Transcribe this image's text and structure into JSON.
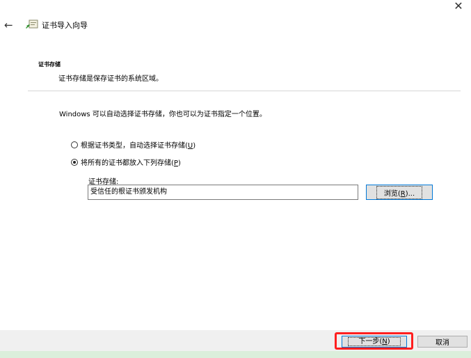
{
  "window": {
    "close_icon": "close-icon",
    "back_icon": "back-arrow-icon"
  },
  "header": {
    "title": "证书导入向导",
    "icon": "certificate-wizard-icon"
  },
  "section": {
    "title": "证书存储",
    "description": "证书存储是保存证书的系统区域。"
  },
  "intro": "Windows 可以自动选择证书存储，你也可以为证书指定一个位置。",
  "options": [
    {
      "label": "根据证书类型，自动选择证书存储(",
      "key": "U",
      "tail": ")",
      "selected": false
    },
    {
      "label": "将所有的证书都放入下列存储(",
      "key": "P",
      "tail": ")",
      "selected": true
    }
  ],
  "store": {
    "label": "证书存储:",
    "value": "受信任的根证书颁发机构"
  },
  "browse": {
    "label": "浏览(",
    "key": "R",
    "tail": ")..."
  },
  "footer": {
    "next": {
      "label": "下一步(",
      "key": "N",
      "tail": ")"
    },
    "cancel": "取消",
    "highlight_color": "#ff1f1f"
  }
}
